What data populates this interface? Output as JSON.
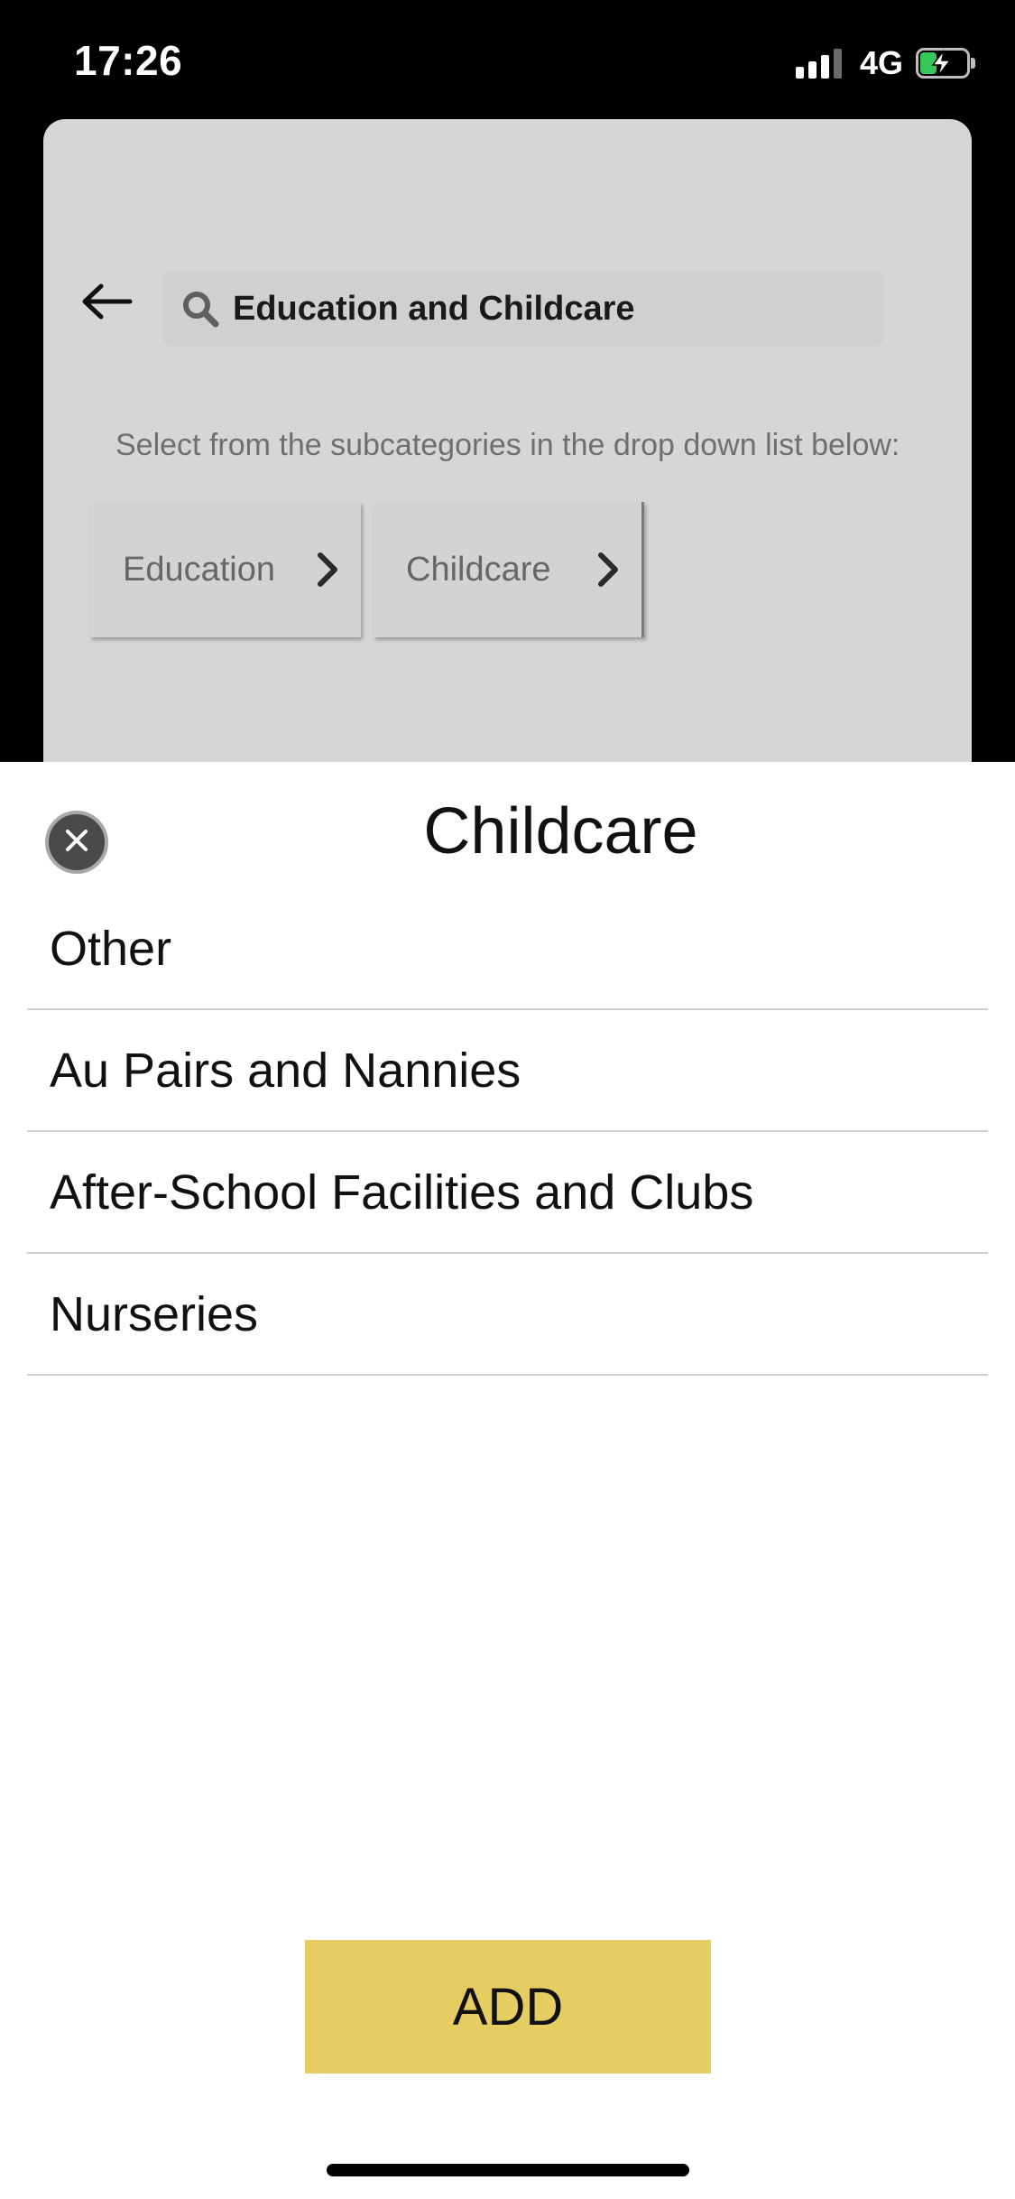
{
  "status_bar": {
    "time": "17:26",
    "network": "4G",
    "signal_icon": "signal-bars-icon",
    "battery_icon": "battery-charging-icon",
    "battery_color": "#34c759"
  },
  "header": {
    "back_icon": "arrow-left-icon",
    "search_icon": "search-icon",
    "search_value": "Education and Childcare"
  },
  "subcategories": {
    "instruction": "Select from the subcategories in the drop down list below:",
    "chips": [
      {
        "label": "Education",
        "icon": "chevron-right-icon"
      },
      {
        "label": "Childcare",
        "icon": "chevron-right-icon"
      }
    ]
  },
  "sheet": {
    "close_icon": "close-icon",
    "title": "Childcare",
    "options": [
      "Other",
      "Au Pairs and Nannies",
      "After-School Facilities and Clubs",
      "Nurseries"
    ],
    "add_label": "ADD",
    "add_color": "#e6cd61"
  }
}
